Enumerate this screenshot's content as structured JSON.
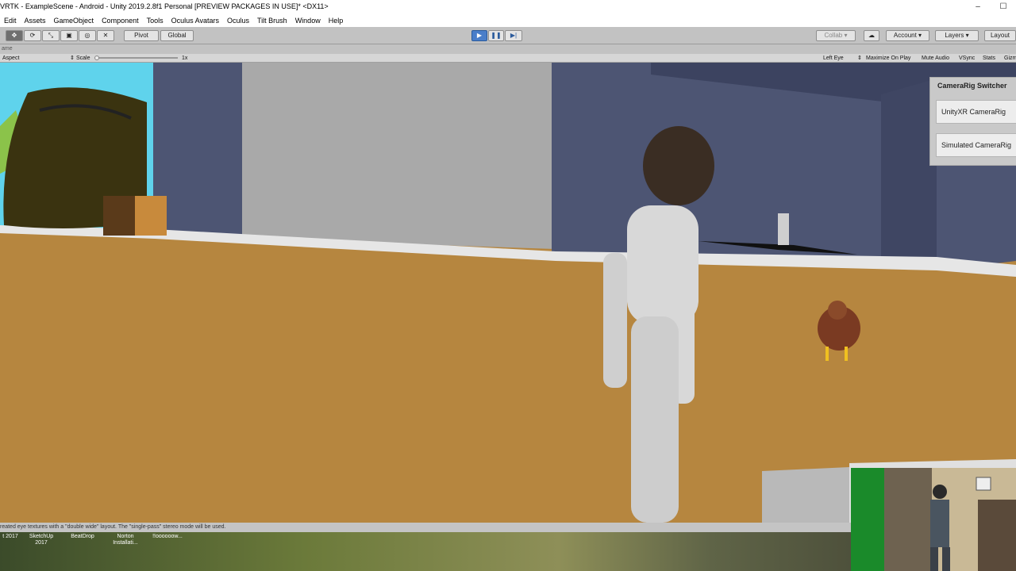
{
  "window": {
    "title": "VRTK - ExampleScene - Android - Unity 2019.2.8f1 Personal [PREVIEW PACKAGES IN USE]* <DX11>",
    "minimize": "–",
    "maximize": "☐"
  },
  "menu": [
    "Edit",
    "Assets",
    "GameObject",
    "Component",
    "Tools",
    "Oculus Avatars",
    "Oculus",
    "Tilt Brush",
    "Window",
    "Help"
  ],
  "toolbar": {
    "pivot": "Pivot",
    "global": "Global",
    "collab": "Collab",
    "account": "Account",
    "layers": "Layers",
    "layout": "Layout"
  },
  "subbar_label": "ame",
  "gamebar": {
    "aspect": "Aspect",
    "scale_label": "Scale",
    "scale_value": "1x",
    "left_eye": "Left Eye",
    "maximize_on_play": "Maximize On Play",
    "mute_audio": "Mute Audio",
    "vsync": "VSync",
    "stats": "Stats",
    "gizmos": "Gizm"
  },
  "camerarig_switcher": {
    "title": "CameraRig Switcher",
    "buttons": [
      "UnityXR CameraRig",
      "Simulated CameraRig"
    ]
  },
  "status_message": "reated eye textures with a \"double wide\" layout. The \"single-pass\" stereo mode will be used.",
  "desktop_icons": [
    "t 2017",
    "SketchUp 2017",
    "BeatDrop",
    "Norton Installati...",
    "!!oooooow..."
  ],
  "colors": {
    "sky": "#5fd3ec",
    "ground": "#b6863f",
    "wall": "#4d5573",
    "play_accent": "#4a7ec9"
  }
}
